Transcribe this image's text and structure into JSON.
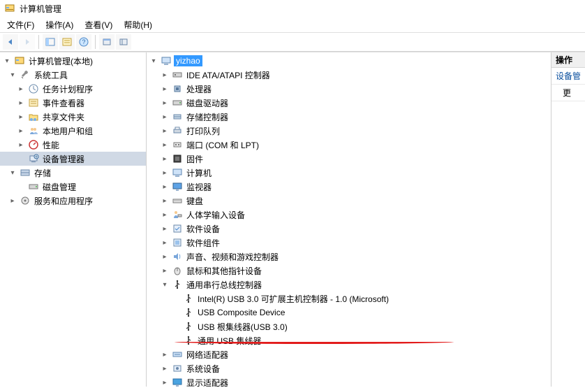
{
  "window": {
    "title": "计算机管理"
  },
  "menu": {
    "file": "文件(F)",
    "action": "操作(A)",
    "view": "查看(V)",
    "help": "帮助(H)"
  },
  "toolbar_icons": {
    "back": "←",
    "forward": "→"
  },
  "left_tree": {
    "root": "计算机管理(本地)",
    "system_tools": "系统工具",
    "task_scheduler": "任务计划程序",
    "event_viewer": "事件查看器",
    "shared_folders": "共享文件夹",
    "local_users": "本地用户和组",
    "performance": "性能",
    "device_manager": "设备管理器",
    "storage": "存储",
    "disk_management": "磁盘管理",
    "services_apps": "服务和应用程序"
  },
  "center_tree": {
    "root": "yizhao",
    "ide": "IDE ATA/ATAPI 控制器",
    "cpu": "处理器",
    "disk_drives": "磁盘驱动器",
    "storage_ctrl": "存储控制器",
    "print_queues": "打印队列",
    "ports": "端口 (COM 和 LPT)",
    "firmware": "固件",
    "computer": "计算机",
    "monitors": "监视器",
    "keyboards": "键盘",
    "hid": "人体学输入设备",
    "software_devices": "软件设备",
    "software_components": "软件组件",
    "sound": "声音、视频和游戏控制器",
    "mouse": "鼠标和其他指针设备",
    "usb_ctrl": "通用串行总线控制器",
    "usb_intel": "Intel(R) USB 3.0 可扩展主机控制器 - 1.0 (Microsoft)",
    "usb_composite": "USB Composite Device",
    "usb_root_hub": "USB 根集线器(USB 3.0)",
    "usb_hub": "通用 USB 集线器",
    "network": "网络适配器",
    "system_devices": "系统设备",
    "display": "显示适配器"
  },
  "right_panel": {
    "header": "操作",
    "section": "设备管",
    "link": "更"
  }
}
